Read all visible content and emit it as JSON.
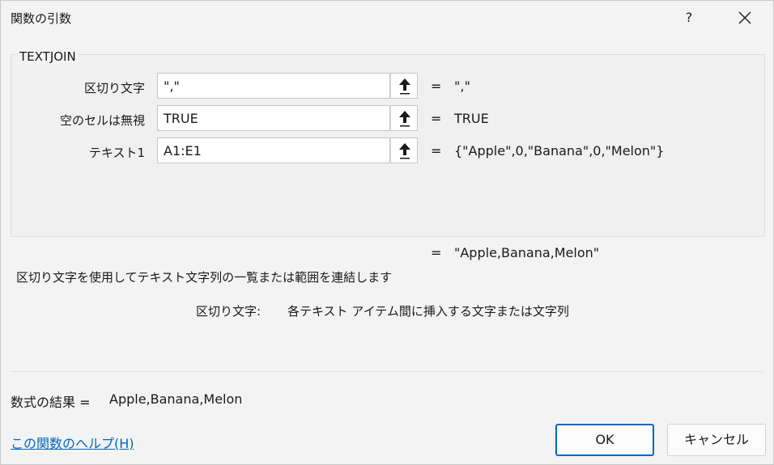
{
  "window": {
    "title": "関数の引数",
    "help_label": "?"
  },
  "function": {
    "name": "TEXTJOIN",
    "args": [
      {
        "label": "区切り文字",
        "input": "\",\"",
        "eq": "=",
        "value": "\",\""
      },
      {
        "label": "空のセルは無視",
        "input": "TRUE",
        "eq": "=",
        "value": "TRUE"
      },
      {
        "label": "テキスト1",
        "input": "A1:E1",
        "eq": "=",
        "value": "{\"Apple\",0,\"Banana\",0,\"Melon\"}"
      }
    ],
    "result_eq": "=",
    "result_value": "\"Apple,Banana,Melon\"",
    "description": "区切り文字を使用してテキスト文字列の一覧または範囲を連結します",
    "arg_desc_name": "区切り文字:",
    "arg_desc_text": "各テキスト アイテム間に挿入する文字または文字列"
  },
  "footer": {
    "formula_label": "数式の結果 =",
    "formula_value": "Apple,Banana,Melon",
    "help_link": "この関数のヘルプ(H)",
    "ok_label": "OK",
    "cancel_label": "キャンセル"
  },
  "icons": {
    "close": "close-icon",
    "ref": "collapse-arrow-icon"
  }
}
